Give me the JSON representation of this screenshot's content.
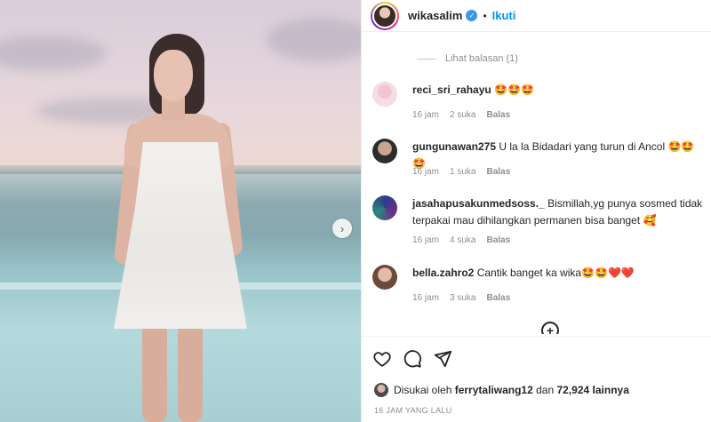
{
  "header": {
    "username": "wikasalim",
    "separator": "•",
    "follow_label": "Ikuti"
  },
  "view_replies": "Lihat balasan (1)",
  "comments": [
    {
      "username": "reci_sri_rahayu",
      "text": "🤩🤩🤩",
      "time": "16 jam",
      "likes": "2 suka",
      "reply": "Balas"
    },
    {
      "username": "gungunawan275",
      "text": "U la la Bidadari yang turun di Ancol 🤩🤩🤩",
      "time": "16 jam",
      "likes": "1 suka",
      "reply": "Balas"
    },
    {
      "username": "jasahapusakunmedsoss._",
      "text": "Bismillah,yg punya sosmed tidak terpakai mau dihilangkan permanen bisa banget 🥰",
      "time": "16 jam",
      "likes": "4 suka",
      "reply": "Balas"
    },
    {
      "username": "bella.zahro2",
      "text": "Cantik banget ka wika🤩🤩❤️❤️",
      "time": "16 jam",
      "likes": "3 suka",
      "reply": "Balas"
    }
  ],
  "likes": {
    "prefix": "Disukai oleh",
    "user": "ferrytaliwang12",
    "connector": "dan",
    "count": "72,924",
    "suffix": "lainnya"
  },
  "timestamp": "16 JAM YANG LALU",
  "icons": {
    "next": "chevron-right-icon",
    "like": "heart-icon",
    "comment": "comment-icon",
    "share": "paper-plane-icon",
    "more_comments": "plus-circle-icon",
    "verified": "verified-badge-icon"
  },
  "colors": {
    "accent": "#0095f6",
    "muted": "#8e8e8e",
    "verified": "#3897f0"
  }
}
